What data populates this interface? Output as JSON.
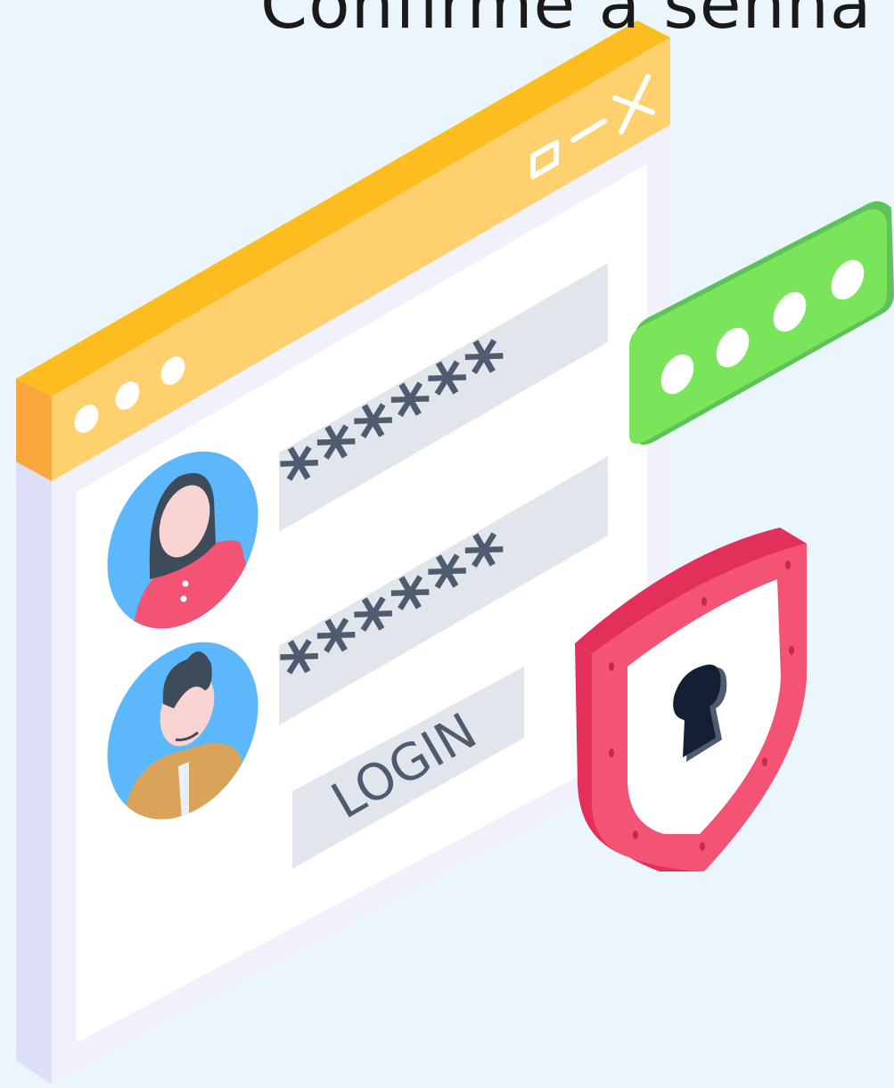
{
  "heading": "Confirme a senha",
  "window": {
    "control_icons": [
      "maximize-icon",
      "minimize-icon",
      "close-icon"
    ],
    "password_mask_1": "******",
    "password_mask_2": "******",
    "login_label": "LOGIN"
  },
  "pin_badge": {
    "dots_count": 4
  },
  "colors": {
    "background": "#eaf6fc",
    "titlebar": "#fed16e",
    "titlebar_edge": "#fdbc20",
    "window_body": "#ffffff",
    "window_side": "#dddff6",
    "field": "#e1e5ec",
    "text_dark": "#4f5b6e",
    "avatar_bg": "#5db8fb",
    "pin_green": "#7ae45b",
    "shield_red": "#f35474",
    "shield_edge": "#e2305a"
  }
}
